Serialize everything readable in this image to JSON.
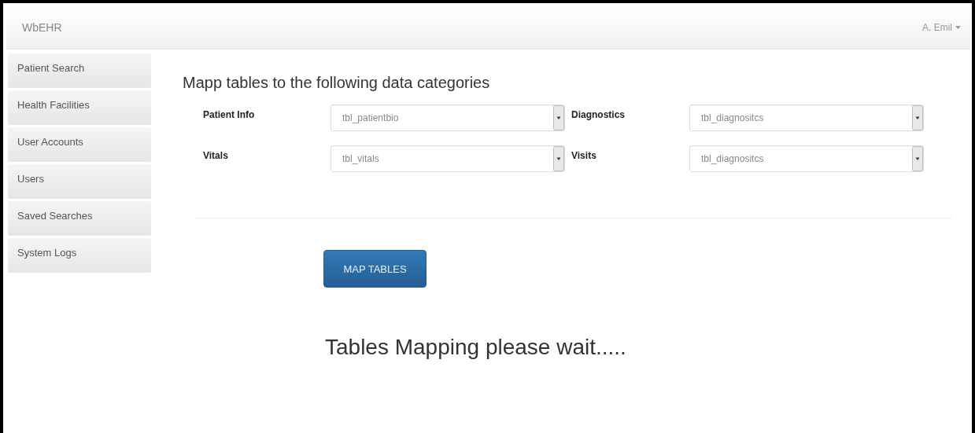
{
  "navbar": {
    "brand": "WbEHR",
    "user": "A. Emil"
  },
  "sidebar": {
    "items": [
      {
        "label": "Patient Search"
      },
      {
        "label": "Health Facilities"
      },
      {
        "label": "User Accounts"
      },
      {
        "label": "Users"
      },
      {
        "label": "Saved Searches"
      },
      {
        "label": "System Logs"
      }
    ]
  },
  "heading": "Mapp tables to the following data categories",
  "mappings": [
    {
      "label": "Patient Info",
      "value": "tbl_patientbio"
    },
    {
      "label": "Diagnostics",
      "value": "tbl_diagnositcs"
    },
    {
      "label": "Vitals",
      "value": "tbl_vitals"
    },
    {
      "label": "Visits",
      "value": "tbl_diagnositcs"
    }
  ],
  "button": "MAP TABLES",
  "status": "Tables Mapping please wait....."
}
